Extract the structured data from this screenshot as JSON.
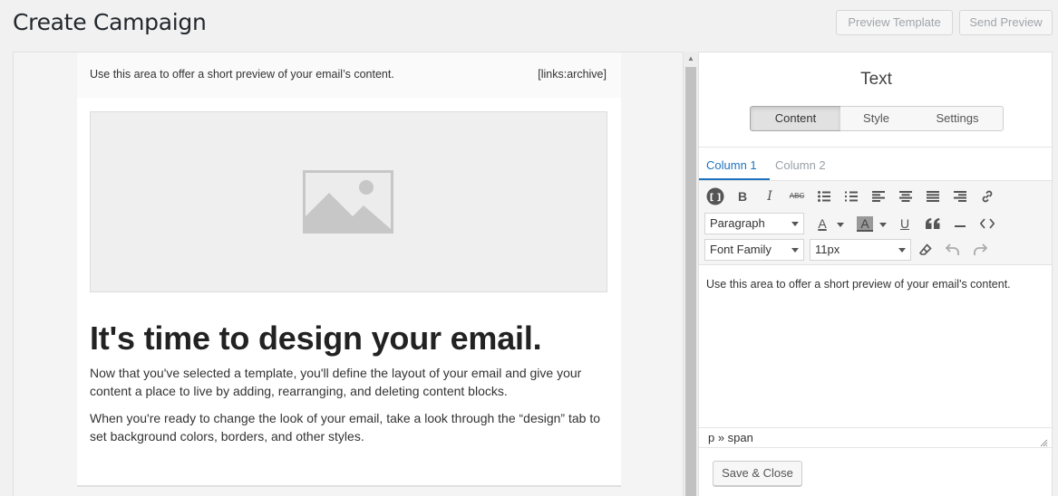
{
  "header": {
    "title": "Create Campaign",
    "preview_template_label": "Preview Template",
    "send_preview_label": "Send Preview"
  },
  "email": {
    "preheader_text": "Use this area to offer a short preview of your email’s content.",
    "archive_tag": "[links:archive]",
    "headline": "It's time to design your email.",
    "paragraph1": "Now that you've selected a template, you'll define the layout of your email and give your content a place to live by adding, rearranging, and deleting content blocks.",
    "paragraph2": "When you're ready to change the look of your email, take a look through the “design” tab to set background colors, borders, and other styles."
  },
  "panel": {
    "title": "Text",
    "segments": [
      "Content",
      "Style",
      "Settings"
    ],
    "active_segment": "Content",
    "column_tabs": [
      "Column 1",
      "Column 2"
    ],
    "active_column": "Column 1",
    "toolbar": {
      "format_select": "Paragraph",
      "font_family_select": "Font Family",
      "font_size_select": "11px",
      "text_color_glyph": "A",
      "highlight_glyph": "A",
      "strikethrough_glyph": "ABC",
      "bold_glyph": "B",
      "italic_glyph": "I",
      "underline_glyph": "U"
    },
    "editor_text": "Use this area to offer a short preview of your email's content.",
    "status_path": "p » span",
    "save_label": "Save & Close"
  },
  "colors": {
    "accent": "#1e73be",
    "background": "#f1f1f1"
  }
}
